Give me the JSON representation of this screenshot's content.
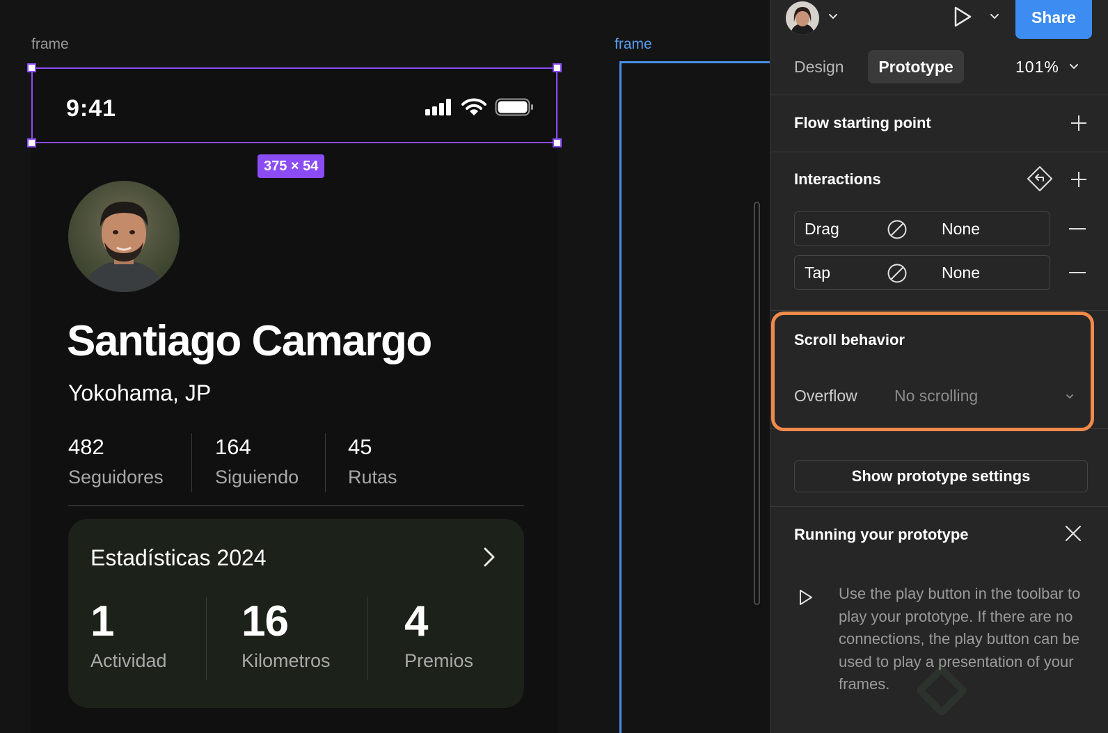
{
  "canvas": {
    "frame1_label": "frame",
    "frame2_label": "frame",
    "selection_size": "375 × 54"
  },
  "phone": {
    "status_time": "9:41",
    "profile": {
      "name": "Santiago Camargo",
      "location": "Yokohama, JP"
    },
    "stats": [
      {
        "value": "482",
        "label": "Seguidores"
      },
      {
        "value": "164",
        "label": "Siguiendo"
      },
      {
        "value": "45",
        "label": "Rutas"
      }
    ],
    "card": {
      "title": "Estadísticas 2024",
      "stats": [
        {
          "value": "1",
          "label": "Actividad"
        },
        {
          "value": "16",
          "label": "Kilometros"
        },
        {
          "value": "4",
          "label": "Premios"
        }
      ]
    }
  },
  "panel": {
    "share_label": "Share",
    "tabs": [
      {
        "label": "Design",
        "active": false
      },
      {
        "label": "Prototype",
        "active": true
      }
    ],
    "zoom": "101%",
    "flow_title": "Flow starting point",
    "interactions_title": "Interactions",
    "interactions": [
      {
        "trigger": "Drag",
        "action": "None"
      },
      {
        "trigger": "Tap",
        "action": "None"
      }
    ],
    "scroll_title": "Scroll behavior",
    "overflow_label": "Overflow",
    "overflow_value": "No scrolling",
    "settings_button": "Show prototype settings",
    "running_title": "Running your prototype",
    "running_text": "Use the play button in the toolbar to play your prototype. If there are no connections, the play button can be used to play a presentation of your frames."
  },
  "colors": {
    "accent_blue": "#3d8cf2",
    "selection_purple": "#8b4cf6",
    "highlight_orange": "#f08a4b",
    "card_bg": "#1c2119"
  },
  "icons": [
    "cellular-icon",
    "wifi-icon",
    "battery-icon",
    "chevron-right-icon",
    "chevron-down-icon",
    "play-icon",
    "plus-icon",
    "minus-icon",
    "no-action-icon",
    "close-icon",
    "interaction-flow-icon"
  ]
}
